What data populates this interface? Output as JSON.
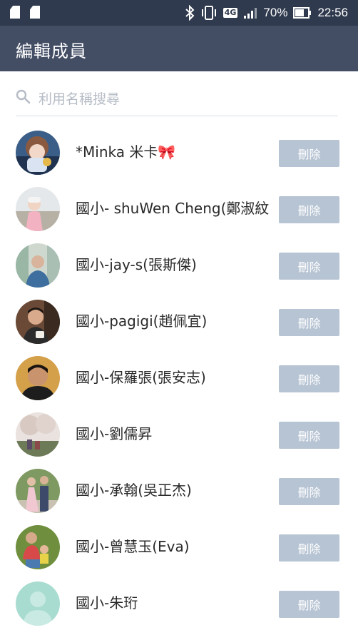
{
  "status_bar": {
    "battery": "70%",
    "time": "22:56",
    "network": "4G"
  },
  "header": {
    "title": "編輯成員"
  },
  "search": {
    "placeholder": "利用名稱搜尋"
  },
  "members": [
    {
      "name": "*Minka 米卡🎀",
      "delete_label": "刪除",
      "avatar": "photo-girl-doll"
    },
    {
      "name": "國小- shuWen Cheng(鄭淑紋",
      "delete_label": "刪除",
      "avatar": "photo-woman-outdoor"
    },
    {
      "name": "國小-jay-s(張斯傑)",
      "delete_label": "刪除",
      "avatar": "photo-man-bookshelf"
    },
    {
      "name": "國小-pagigi(趙佩宜)",
      "delete_label": "刪除",
      "avatar": "photo-man-cup"
    },
    {
      "name": "國小-保羅張(張安志)",
      "delete_label": "刪除",
      "avatar": "photo-man-portrait"
    },
    {
      "name": "國小-劉儒昇",
      "delete_label": "刪除",
      "avatar": "photo-tree-family"
    },
    {
      "name": "國小-承翰(吳正杰)",
      "delete_label": "刪除",
      "avatar": "photo-wedding-couple"
    },
    {
      "name": "國小-曾慧玉(Eva)",
      "delete_label": "刪除",
      "avatar": "photo-mother-kids"
    },
    {
      "name": "國小-朱珩",
      "delete_label": "刪除",
      "avatar": "default-avatar"
    }
  ],
  "colors": {
    "status_bar": "#2f3a4e",
    "app_bar": "#434d64",
    "delete_button": "#b7c4d3",
    "default_avatar": "#a9dcd0"
  }
}
